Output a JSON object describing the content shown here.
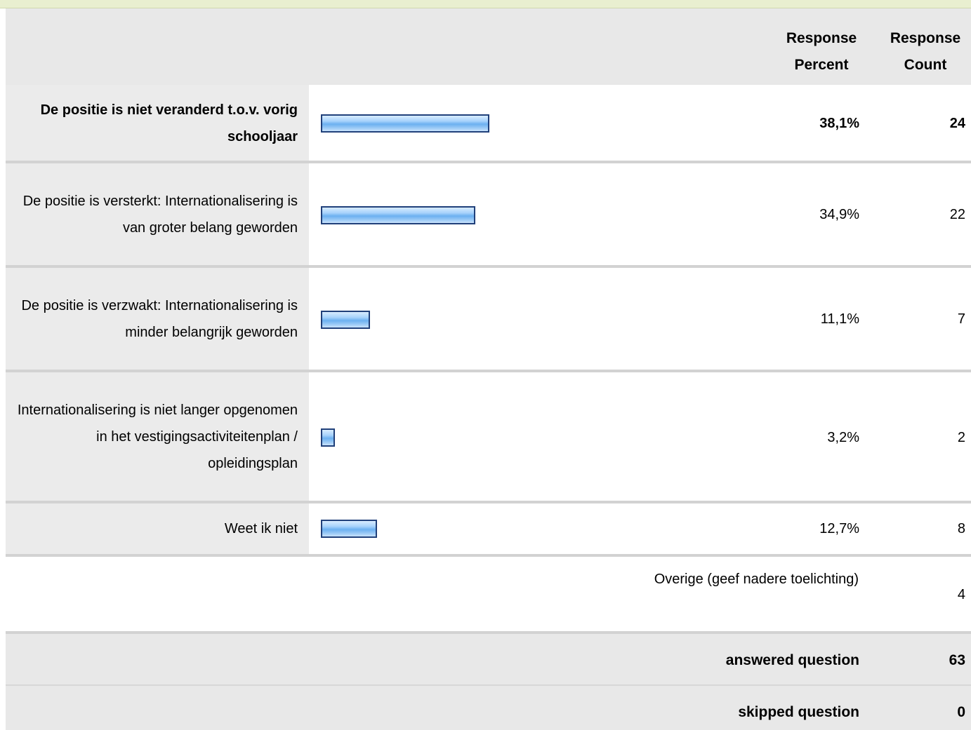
{
  "header": {
    "percent_label": "Response Percent",
    "count_label": "Response Count"
  },
  "chart_data": {
    "type": "bar",
    "xlim": [
      0,
      100
    ],
    "categories": [
      "De positie is niet veranderd t.o.v. vorig schooljaar",
      "De positie is versterkt: Internationalisering is van groter belang geworden",
      "De positie is verzwakt: Internationalisering is minder belangrijk geworden",
      "Internationalisering is niet langer opgenomen in het vestigingsactiviteitenplan / opleidingsplan",
      "Weet ik niet"
    ],
    "series": [
      {
        "name": "Response Percent",
        "values": [
          38.1,
          34.9,
          11.1,
          3.2,
          12.7
        ]
      },
      {
        "name": "Response Count",
        "values": [
          24,
          22,
          7,
          2,
          8
        ]
      }
    ]
  },
  "rows": [
    {
      "label": "De positie is niet veranderd t.o.v. vorig schooljaar",
      "percent": "38,1%",
      "count": "24"
    },
    {
      "label": "De positie is versterkt: Internationalisering is van groter belang geworden",
      "percent": "34,9%",
      "count": "22"
    },
    {
      "label": "De positie is verzwakt: Internationalisering is minder belangrijk geworden",
      "percent": "11,1%",
      "count": "7"
    },
    {
      "label": "Internationalisering is niet langer opgenomen in het vestigingsactiviteitenplan / opleidingsplan",
      "percent": "3,2%",
      "count": "2"
    },
    {
      "label": "Weet ik niet",
      "percent": "12,7%",
      "count": "8"
    }
  ],
  "other": {
    "label": "Overige (geef nadere toelichting)",
    "count": "4"
  },
  "summary": {
    "answered_label": "answered question",
    "answered_value": "63",
    "skipped_label": "skipped question",
    "skipped_value": "0"
  },
  "colors": {
    "bar_border": "#20407a",
    "bar_fill": "#6bb0f0",
    "header_bg": "#e8e8e8"
  }
}
